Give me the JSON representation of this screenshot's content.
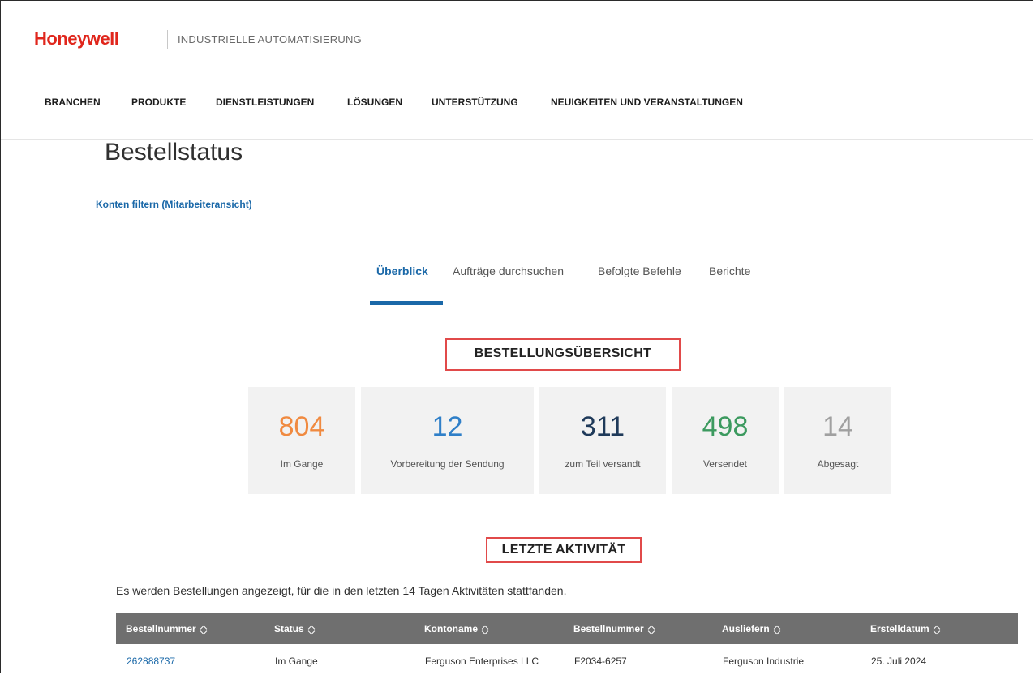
{
  "header": {
    "brand": "Honeywell",
    "tagline": "INDUSTRIELLE AUTOMATISIERUNG",
    "brand_color": "#e0261c"
  },
  "nav": {
    "items": [
      "BRANCHEN",
      "PRODUKTE",
      "DIENSTLEISTUNGEN",
      "LÖSUNGEN",
      "UNTERSTÜTZUNG",
      "NEUIGKEITEN UND VERANSTALTUNGEN"
    ]
  },
  "page": {
    "title": "Bestellstatus",
    "filter_link": "Konten filtern (Mitarbeiteransicht)"
  },
  "tabs": [
    {
      "label": "Überblick",
      "active": true
    },
    {
      "label": "Aufträge durchsuchen",
      "active": false
    },
    {
      "label": "Befolgte Befehle",
      "active": false
    },
    {
      "label": "Berichte",
      "active": false
    }
  ],
  "overview": {
    "title": "BESTELLUNGSÜBERSICHT",
    "cards": [
      {
        "value": "804",
        "label": "Im Gange",
        "color": "#f08a40"
      },
      {
        "value": "12",
        "label": "Vorbereitung der Sendung",
        "color": "#2f7fc8"
      },
      {
        "value": "311",
        "label": "zum Teil versandt",
        "color": "#1f3a5a"
      },
      {
        "value": "498",
        "label": "Versendet",
        "color": "#3c9a5f"
      },
      {
        "value": "14",
        "label": "Abgesagt",
        "color": "#a0a0a0"
      }
    ]
  },
  "activity": {
    "title": "LETZTE AKTIVITÄT",
    "description": "Es werden Bestellungen angezeigt, für die in den letzten 14 Tagen Aktivitäten stattfanden.",
    "columns": [
      "Bestellnummer",
      "Status",
      "Kontoname",
      "Bestellnummer",
      "Ausliefern",
      "Erstelldatum"
    ],
    "rows": [
      [
        "262888737",
        "Im Gange",
        "Ferguson Enterprises LLC",
        "F2034-6257",
        "Ferguson Industrie",
        "25. Juli 2024"
      ]
    ]
  }
}
